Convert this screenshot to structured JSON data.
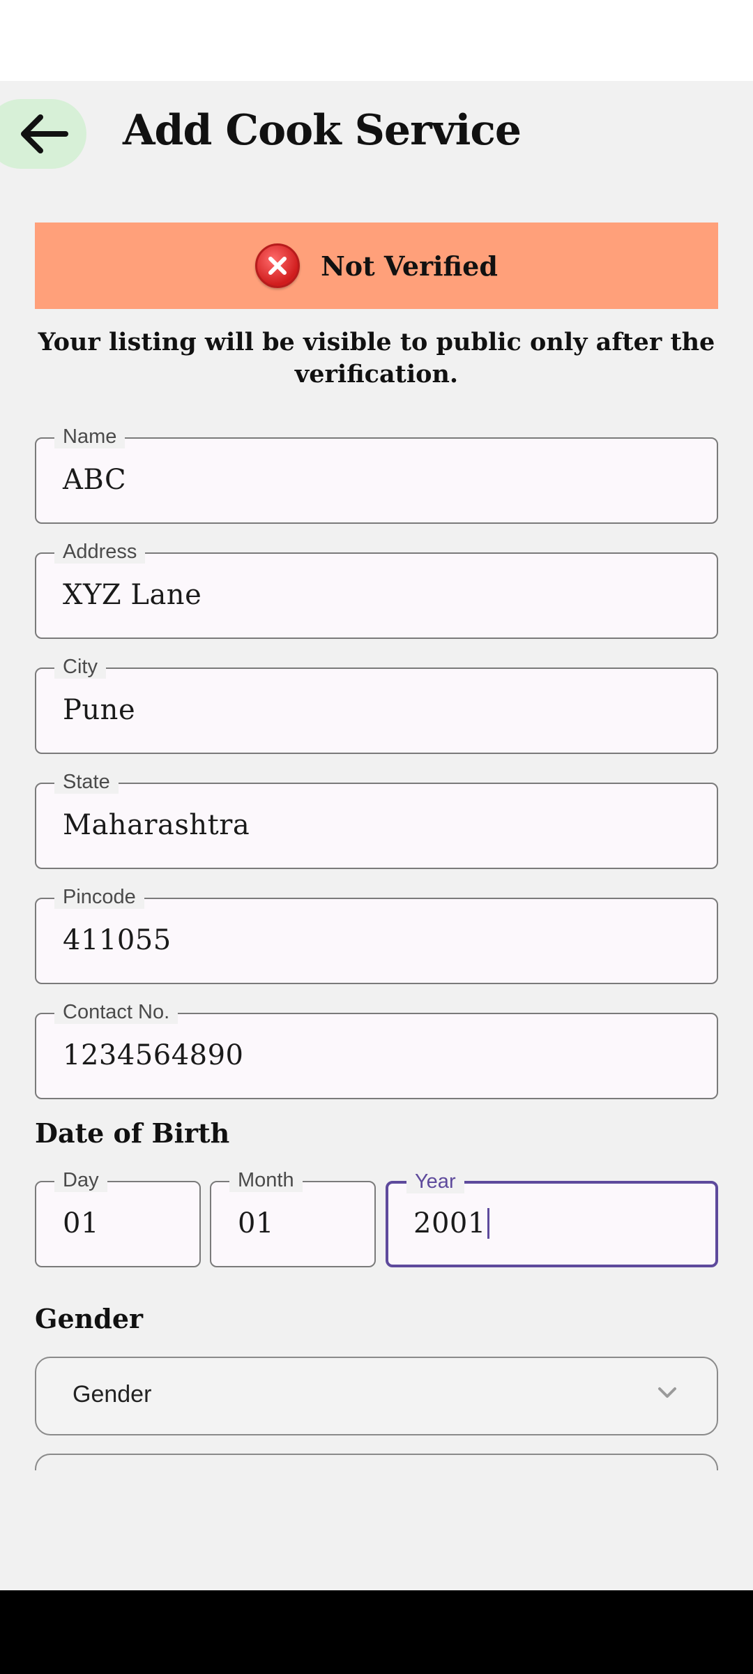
{
  "header": {
    "title": "Add Cook Service"
  },
  "verification": {
    "status": "Not Verified",
    "notice": "Your listing will be visible to public only after the verification."
  },
  "fields": {
    "name": {
      "label": "Name",
      "value": "ABC"
    },
    "address": {
      "label": "Address",
      "value": "XYZ Lane"
    },
    "city": {
      "label": "City",
      "value": "Pune"
    },
    "state": {
      "label": "State",
      "value": "Maharashtra"
    },
    "pincode": {
      "label": "Pincode",
      "value": "411055"
    },
    "contact": {
      "label": "Contact No.",
      "value": "1234564890"
    }
  },
  "dob": {
    "title": "Date of Birth",
    "day": {
      "label": "Day",
      "value": "01"
    },
    "month": {
      "label": "Month",
      "value": "01"
    },
    "year": {
      "label": "Year",
      "value": "2001"
    }
  },
  "gender": {
    "title": "Gender",
    "selected": "Gender"
  },
  "colors": {
    "banner": "#ffa07a",
    "back_button_bg": "#d7f0d7",
    "focus_accent": "#5e4a9c"
  },
  "icons": {
    "back": "arrow-left-icon",
    "status": "error-circle-icon",
    "dropdown": "chevron-down-icon"
  }
}
